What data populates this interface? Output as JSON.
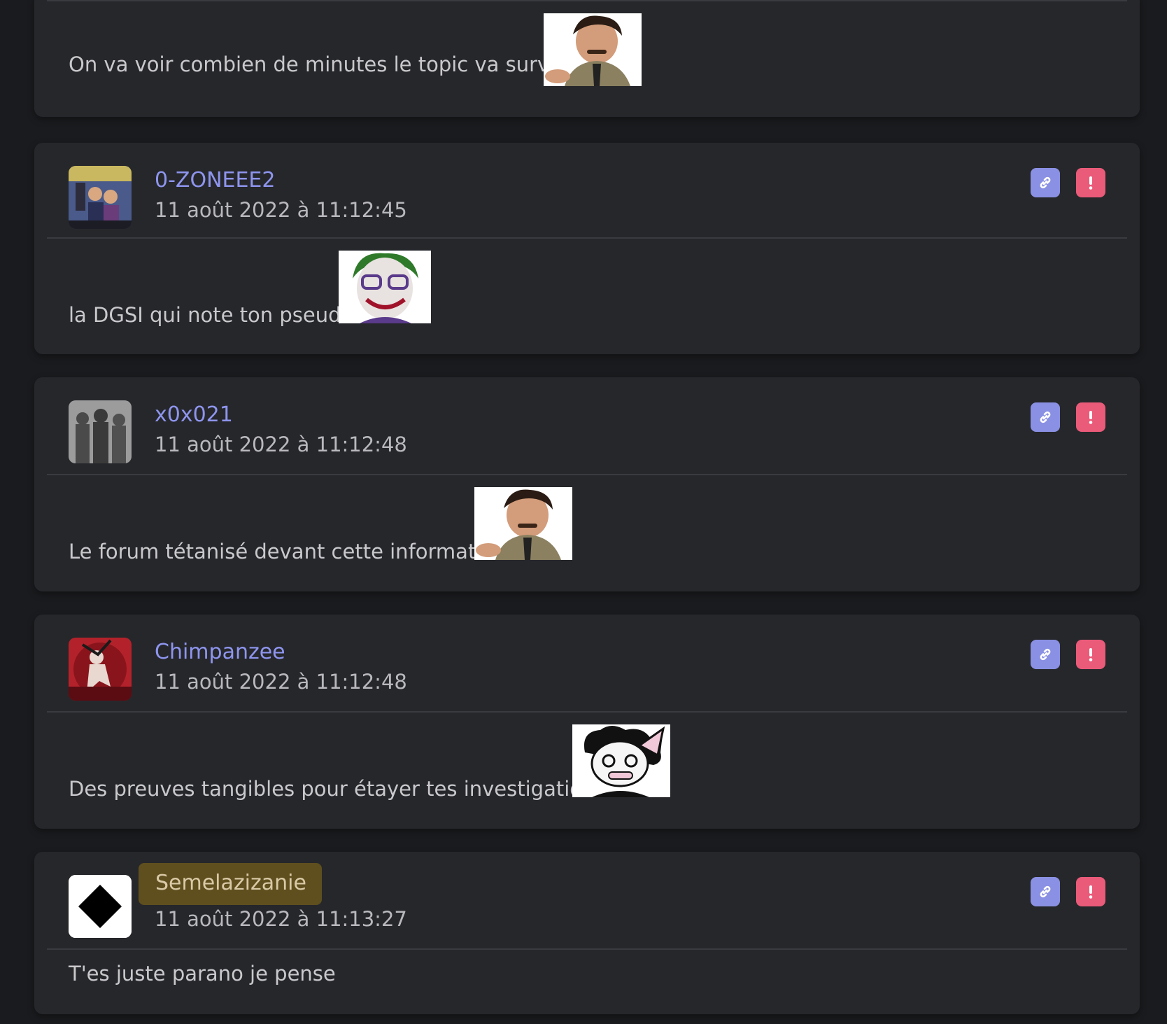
{
  "posts": [
    {
      "body": "On va voir combien de minutes le topic va survivre",
      "sticker": "smug-man-sticker"
    },
    {
      "username": "0-ZONEEE2",
      "timestamp": "11 août 2022 à 11:12:45",
      "body": "la DGSI qui note ton pseudo",
      "sticker": "joker-sticker"
    },
    {
      "username": "x0x021",
      "timestamp": "11 août 2022 à 11:12:48",
      "body": "Le forum tétanisé devant cette information",
      "sticker": "smug-man-sticker"
    },
    {
      "username": "Chimpanzee",
      "timestamp": "11 août 2022 à 11:12:48",
      "body": "Des preuves tangibles pour étayer tes investigations ?",
      "sticker": "cartoon-character-sticker"
    },
    {
      "username": "Semelazizanie",
      "timestamp": "11 août 2022 à 11:13:27",
      "body": "T'es juste parano je pense"
    }
  ],
  "colors": {
    "background": "#1a1b1e",
    "card": "#26272b",
    "username": "#8e95ee",
    "link_button": "#8a90e3",
    "report_button": "#ea5a79",
    "highlight": "#5f4f1e"
  },
  "icons": {
    "link_button": "link-icon",
    "report_button": "exclamation-icon"
  }
}
